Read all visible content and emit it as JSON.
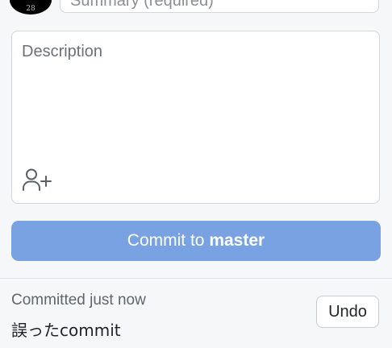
{
  "avatar": {
    "text": "28"
  },
  "summary": {
    "placeholder": "Summary (required)"
  },
  "description": {
    "placeholder": "Description",
    "coauthor_icon": "add-coauthor-icon"
  },
  "commit_button": {
    "prefix": "Commit to ",
    "branch": "master"
  },
  "last_commit": {
    "status": "Committed just now",
    "message": "誤ったcommit",
    "undo_label": "Undo"
  },
  "colors": {
    "commit_button_bg": "#79a2e2",
    "background": "#f6f7f8"
  }
}
